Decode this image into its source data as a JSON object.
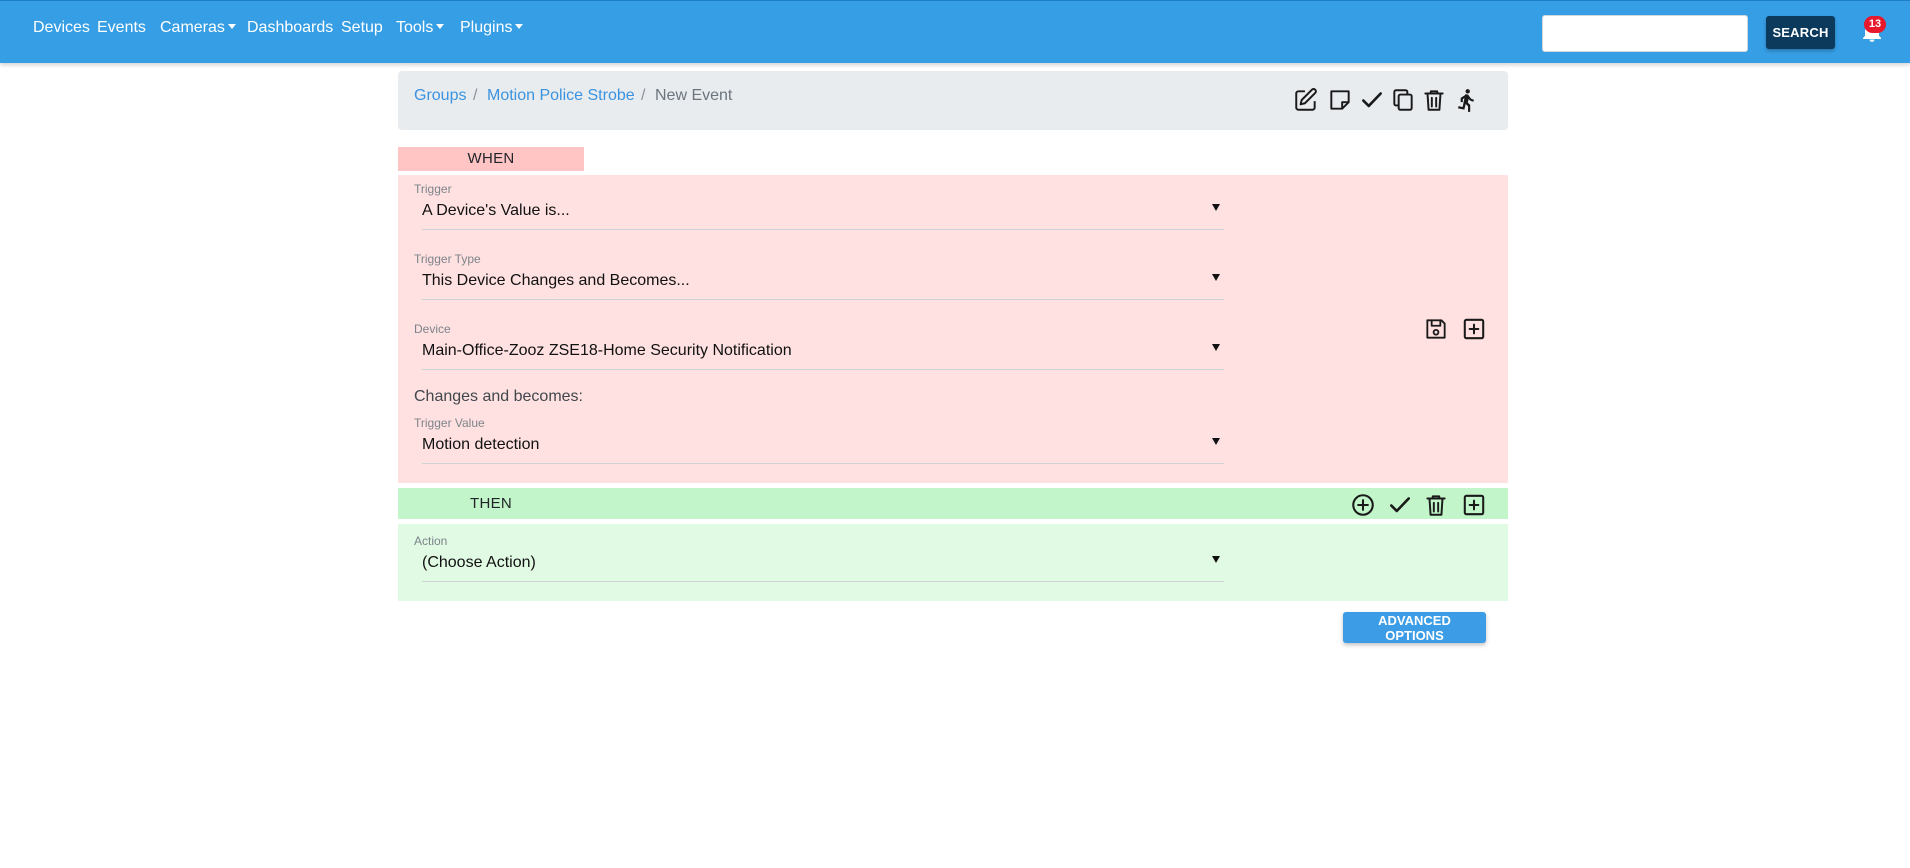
{
  "nav": {
    "items": [
      {
        "label": "Devices",
        "dropdown": false
      },
      {
        "label": "Events",
        "dropdown": false
      },
      {
        "label": "Cameras",
        "dropdown": true
      },
      {
        "label": "Dashboards",
        "dropdown": false
      },
      {
        "label": "Setup",
        "dropdown": false
      },
      {
        "label": "Tools",
        "dropdown": true
      },
      {
        "label": "Plugins",
        "dropdown": true
      }
    ],
    "search": {
      "value": "",
      "placeholder": ""
    },
    "search_button": "SEARCH",
    "notification_count": "13",
    "bell_icon": "bell-icon",
    "color": "#369ee4"
  },
  "breadcrumb": {
    "items": [
      "Groups",
      "Motion Police Strobe",
      "New Event"
    ],
    "separator": "/",
    "tools": [
      "edit-icon",
      "note-icon",
      "check-icon",
      "copy-icon",
      "trash-icon",
      "run-icon"
    ]
  },
  "when": {
    "label": "WHEN",
    "color": "#ffe1e1",
    "trigger": {
      "label": "Trigger",
      "value": "A Device's Value is..."
    },
    "trigger_type": {
      "label": "Trigger Type",
      "value": "This Device Changes and Becomes..."
    },
    "device": {
      "label": "Device",
      "value": "Main-Office-Zooz ZSE18-Home Security Notification"
    },
    "changes_text": "Changes and becomes:",
    "trigger_value": {
      "label": "Trigger Value",
      "value": "Motion detection"
    },
    "icons": [
      "save-icon",
      "add-box-icon"
    ]
  },
  "then": {
    "label": "THEN",
    "color": "#c2f5c9",
    "icons": [
      "add-circle-icon",
      "check-icon",
      "trash-icon",
      "add-box-icon"
    ],
    "action": {
      "label": "Action",
      "value": "(Choose Action)"
    }
  },
  "advanced_button": "ADVANCED OPTIONS"
}
